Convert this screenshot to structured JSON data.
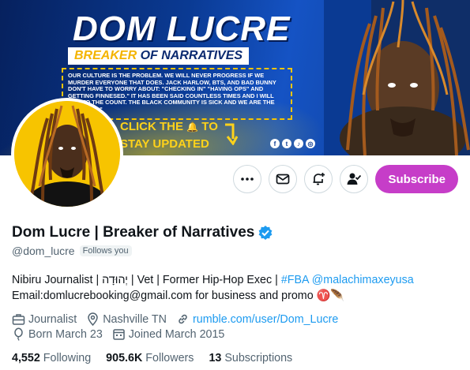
{
  "banner": {
    "title": "DOM LUCRE",
    "subtitle_a": "BREAKER",
    "subtitle_b": "OF NARRATIVES",
    "quote": "OUR CULTURE IS THE PROBLEM. WE WILL NEVER PROGRESS IF WE MURDER EVERYONE THAT DOES. JACK HARLOW, BTS, AND BAD BUNNY DON'T HAVE TO WORRY ABOUT: \"CHECKING IN\" \"HAVING OPS\" AND GETTING FINNESED.\" IT HAS BEEN SAID COUNTLESS TIMES AND I WILL ADD TO THE COUNT. THE BLACK COMMUNITY IS SICK AND WE ARE THE SOLUTION.\"",
    "cta_line1a": "CLICK THE",
    "cta_line1b": "TO",
    "cta_line2": "STAY UPDATED",
    "socials": [
      "facebook-icon",
      "twitter-icon",
      "tiktok-icon",
      "instagram-icon"
    ]
  },
  "actions": {
    "more": "more-icon",
    "message": "mail-icon",
    "notify": "bell-plus-icon",
    "follow": "person-check-icon",
    "subscribe_label": "Subscribe"
  },
  "profile": {
    "name": "Dom Lucre | Breaker of Narratives",
    "verified": true,
    "handle": "@dom_lucre",
    "follows_you": "Follows you",
    "bio_line1_text": "Nibiru Journalist | יְהוּדָה | Vet | Former Hip-Hop Exec | ",
    "bio_hashtag": "#FBA",
    "bio_mention": "@malachimaxeyusa",
    "bio_line2_text": "Email:domlucrebooking@gmail.com for business and promo ♈🪶",
    "category": "Journalist",
    "location": "Nashville TN",
    "website": "rumble.com/user/Dom_Lucre",
    "birthday": "Born March 23",
    "joined": "Joined March 2015"
  },
  "stats": {
    "following_count": "4,552",
    "following_label": "Following",
    "followers_count": "905.6K",
    "followers_label": "Followers",
    "subscriptions_count": "13",
    "subscriptions_label": "Subscriptions"
  },
  "colors": {
    "subscribe": "#c63dc8",
    "verified": "#1d9bf0",
    "link": "#1d9bf0",
    "banner_blue": "#0a3a93",
    "banner_yellow": "#ffd21a"
  }
}
